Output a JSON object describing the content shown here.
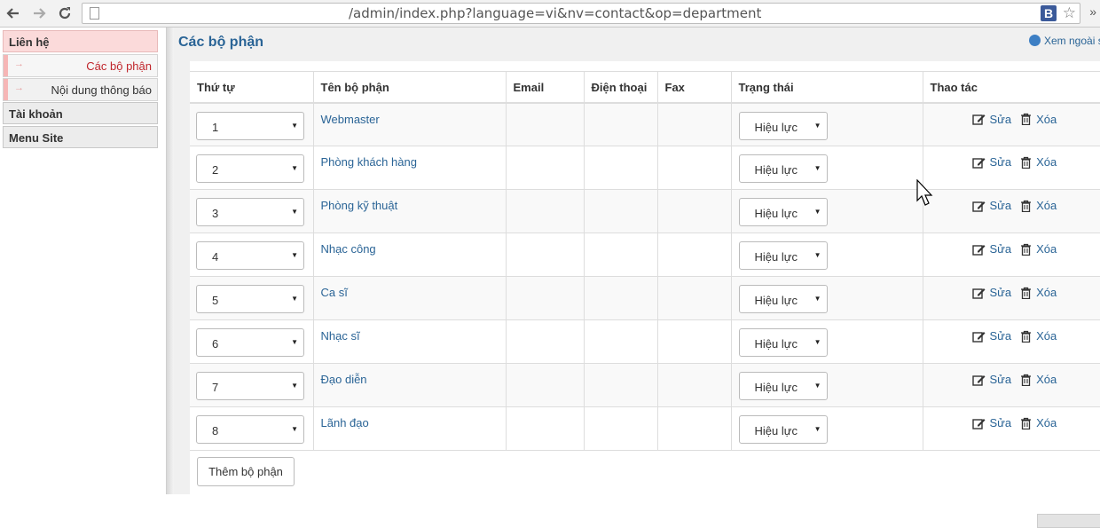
{
  "browser": {
    "url": "/admin/index.php?language=vi&nv=contact&op=department",
    "extension_label": "B",
    "more_label": "»"
  },
  "sidebar": {
    "items": [
      {
        "label": "Liên hệ"
      },
      {
        "label": "Các bộ phận"
      },
      {
        "label": "Nội dung thông báo"
      },
      {
        "label": "Tài khoản"
      },
      {
        "label": "Menu Site"
      }
    ]
  },
  "header": {
    "title": "Các bộ phận",
    "view_link": "Xem ngoài s"
  },
  "table": {
    "columns": [
      "Thứ tự",
      "Tên bộ phận",
      "Email",
      "Điện thoại",
      "Fax",
      "Trạng thái",
      "Thao tác"
    ],
    "rows": [
      {
        "order": "1",
        "name": "Webmaster",
        "status": "Hiệu lực"
      },
      {
        "order": "2",
        "name": "Phòng khách hàng",
        "status": "Hiệu lực"
      },
      {
        "order": "3",
        "name": "Phòng kỹ thuật",
        "status": "Hiệu lực"
      },
      {
        "order": "4",
        "name": "Nhạc công",
        "status": "Hiệu lực"
      },
      {
        "order": "5",
        "name": "Ca sĩ",
        "status": "Hiệu lực"
      },
      {
        "order": "6",
        "name": "Nhạc sĩ",
        "status": "Hiệu lực"
      },
      {
        "order": "7",
        "name": "Đạo diễn",
        "status": "Hiệu lực"
      },
      {
        "order": "8",
        "name": "Lãnh đạo",
        "status": "Hiệu lực"
      }
    ],
    "edit_label": "Sửa",
    "delete_label": "Xóa"
  },
  "add_button": "Thêm bộ phận",
  "colors": {
    "link": "#2a6496",
    "active_menu_bg": "#fbdada",
    "current_submenu_text": "#c0262c"
  },
  "icons": [
    "back-icon",
    "forward-icon",
    "reload-icon",
    "page-icon",
    "star-icon",
    "globe-icon",
    "edit-icon",
    "trash-icon",
    "chevron-down-icon"
  ]
}
